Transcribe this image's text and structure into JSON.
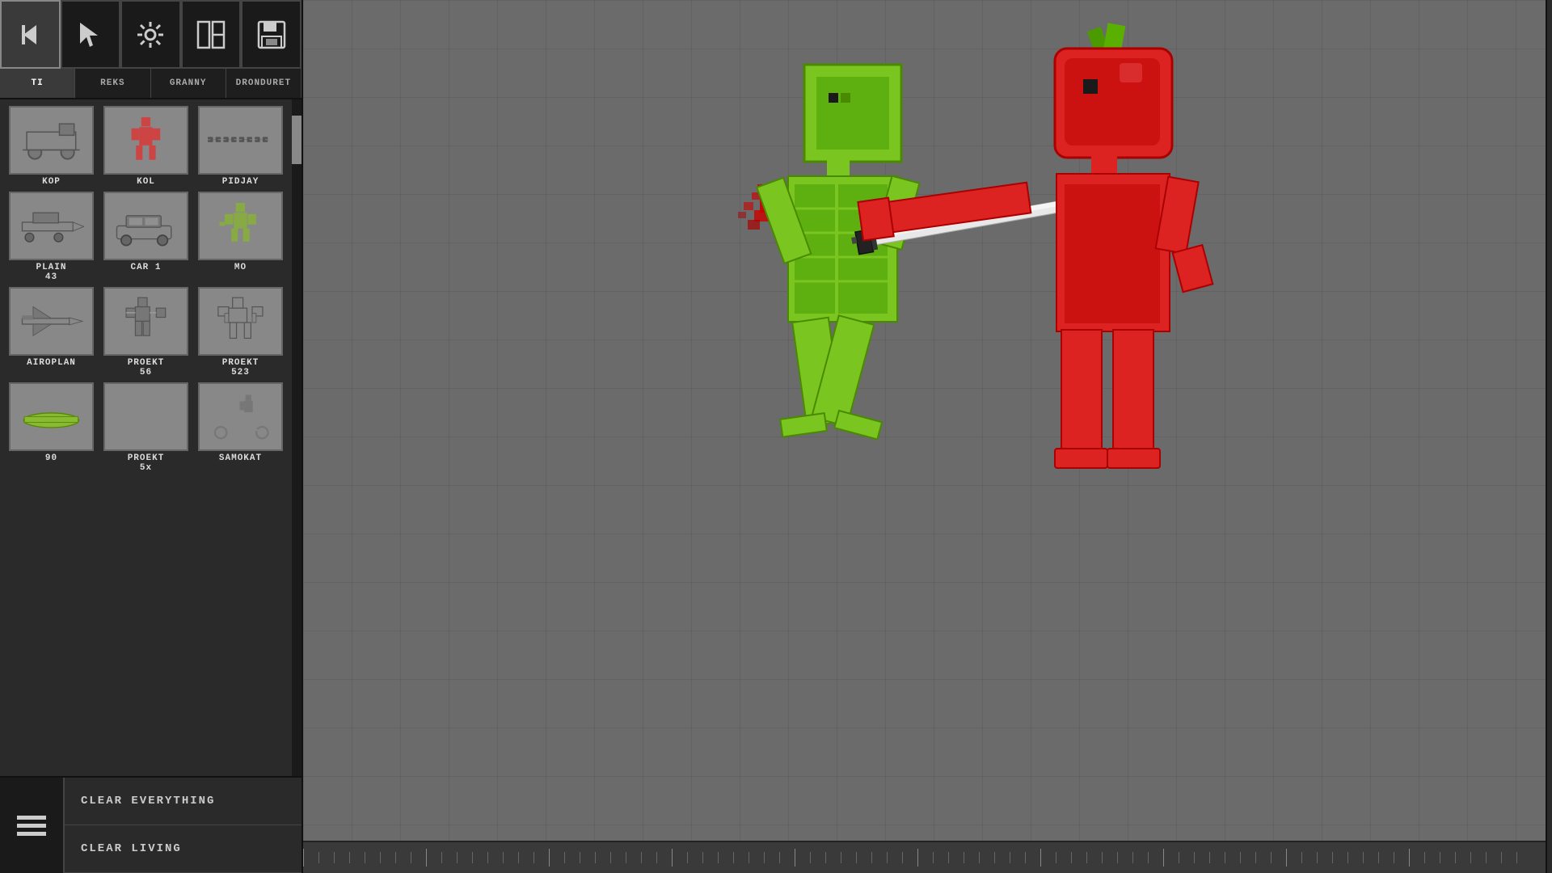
{
  "toolbar": {
    "buttons": [
      {
        "id": "back",
        "icon": "↩",
        "label": "back-button"
      },
      {
        "id": "cursor",
        "icon": "↖",
        "label": "cursor-button"
      },
      {
        "id": "settings",
        "icon": "⚙",
        "label": "settings-button"
      },
      {
        "id": "layout",
        "icon": "▣",
        "label": "layout-button"
      },
      {
        "id": "save",
        "icon": "💾",
        "label": "save-button"
      }
    ]
  },
  "tabs": [
    {
      "id": "ti",
      "label": "TI"
    },
    {
      "id": "reks",
      "label": "REKS"
    },
    {
      "id": "granny",
      "label": "GRANNY"
    },
    {
      "id": "dronduret",
      "label": "DRONDURET"
    }
  ],
  "items": [
    {
      "id": "kop",
      "label": "KOP",
      "type": "vehicle"
    },
    {
      "id": "kol",
      "label": "KOL",
      "type": "figure"
    },
    {
      "id": "pidjay",
      "label": "PIDJAY",
      "type": "chain"
    },
    {
      "id": "plain43",
      "label": "PLAIN\n43",
      "type": "vehicle2"
    },
    {
      "id": "car1",
      "label": "CAR 1",
      "type": "car"
    },
    {
      "id": "mo",
      "label": "MO",
      "type": "figure2"
    },
    {
      "id": "airoplan",
      "label": "AIROPLAN",
      "type": "plane"
    },
    {
      "id": "proekt56",
      "label": "PROEKT\n56",
      "type": "robot2"
    },
    {
      "id": "proekt523",
      "label": "PROEKT\n523",
      "type": "robot3"
    },
    {
      "id": "90",
      "label": "90",
      "type": "green"
    },
    {
      "id": "proekt5x",
      "label": "PROEKT\n5x",
      "type": "dots"
    },
    {
      "id": "samokat",
      "label": "SAMOKAT",
      "type": "scooter"
    }
  ],
  "bottom_buttons": {
    "menu_icon": "≡",
    "clear_everything": "CLEAR EVERYTHING",
    "clear_living": "CLEAR LIVING"
  },
  "scene": {
    "green_character": "Green block figure being stabbed",
    "red_character": "Red apple-headed figure with sword"
  }
}
